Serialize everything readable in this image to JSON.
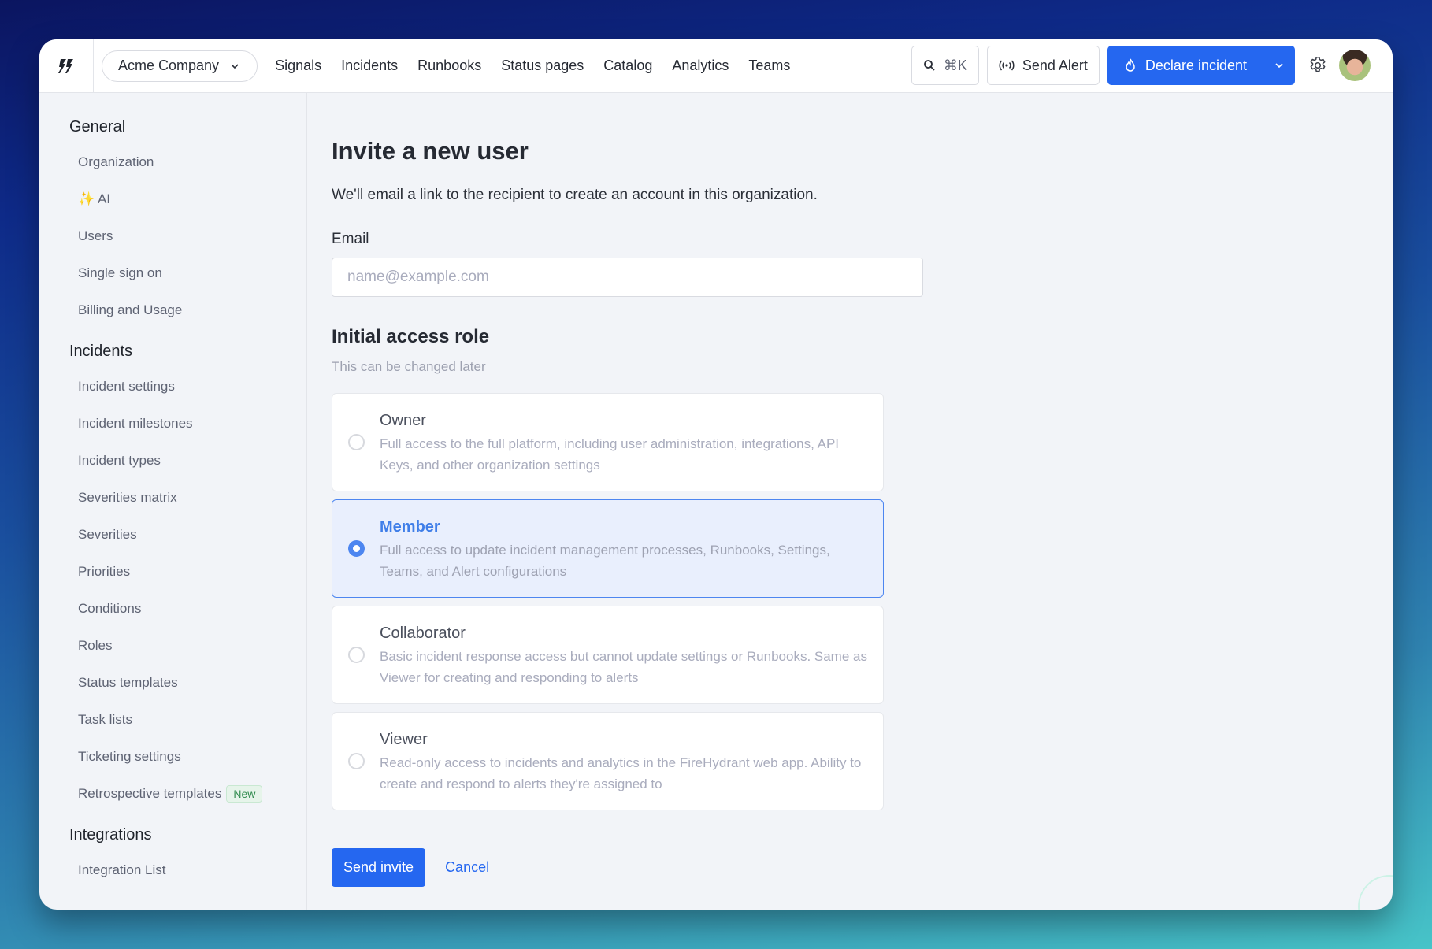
{
  "topbar": {
    "org_name": "Acme Company",
    "nav": [
      "Signals",
      "Incidents",
      "Runbooks",
      "Status pages",
      "Catalog",
      "Analytics",
      "Teams"
    ],
    "search_shortcut": "⌘K",
    "send_alert": "Send Alert",
    "declare_incident": "Declare incident"
  },
  "sidebar": {
    "sections": [
      {
        "title": "General",
        "items": [
          "Organization",
          "✨ AI",
          "Users",
          "Single sign on",
          "Billing and Usage"
        ]
      },
      {
        "title": "Incidents",
        "items": [
          "Incident settings",
          "Incident milestones",
          "Incident types",
          "Severities matrix",
          "Severities",
          "Priorities",
          "Conditions",
          "Roles",
          "Status templates",
          "Task lists",
          "Ticketing settings",
          "Retrospective templates"
        ]
      },
      {
        "title": "Integrations",
        "items": [
          "Integration List"
        ]
      }
    ],
    "new_badge": "New"
  },
  "main": {
    "title": "Invite a new user",
    "lead": "We'll email a link to the recipient to create an account in this organization.",
    "email_label": "Email",
    "email_value": "",
    "email_placeholder": "name@example.com",
    "role_title": "Initial access role",
    "role_subtitle": "This can be changed later",
    "selected_role": "Member",
    "roles": [
      {
        "name": "Owner",
        "description": "Full access to the full platform, including user administration, integrations, API Keys, and other organization settings"
      },
      {
        "name": "Member",
        "description": "Full access to update incident management processes, Runbooks, Settings, Teams, and Alert configurations"
      },
      {
        "name": "Collaborator",
        "description": "Basic incident response access but cannot update settings or Runbooks. Same as Viewer for creating and responding to alerts"
      },
      {
        "name": "Viewer",
        "description": "Read-only access to incidents and analytics in the FireHydrant web app. Ability to create and respond to alerts they're assigned to"
      }
    ],
    "send_invite": "Send invite",
    "cancel": "Cancel"
  },
  "colors": {
    "accent": "#2567f0",
    "selected_role": "#4d86f0",
    "badge_green": "#2f8a4d"
  }
}
